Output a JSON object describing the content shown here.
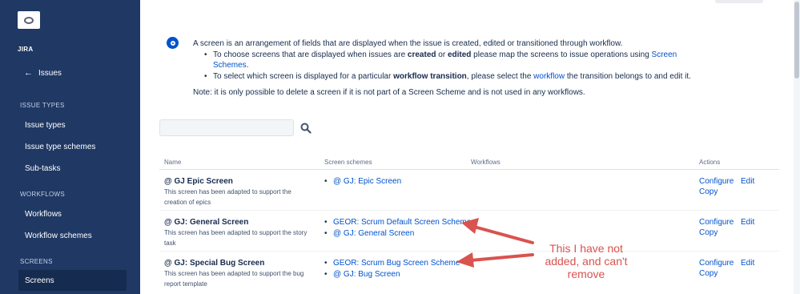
{
  "sidebar": {
    "project": "JIRA",
    "back_label": "Issues",
    "sections": {
      "issue_types": "ISSUE TYPES",
      "workflows": "WORKFLOWS",
      "screens": "SCREENS"
    },
    "items": {
      "issue_types": "Issue types",
      "issue_type_schemes": "Issue type schemes",
      "sub_tasks": "Sub-tasks",
      "workflows": "Workflows",
      "workflow_schemes": "Workflow schemes",
      "screens": "Screens"
    }
  },
  "info": {
    "intro": "A screen is an arrangement of fields that are displayed when the issue is created, edited or transitioned through workflow.",
    "bullet1": {
      "a": "To choose screens that are displayed when issues are ",
      "b1": "created",
      "c": " or ",
      "b2": "edited",
      "d": " please map the screens to issue operations using ",
      "link": "Screen Schemes",
      "e": "."
    },
    "bullet2": {
      "a": "To select which screen is displayed for a particular ",
      "b": "workflow transition",
      "c": ", please select the ",
      "link": "workflow",
      "d": " the transition belongs to and edit it."
    },
    "note": "Note: it is only possible to delete a screen if it is not part of a Screen Scheme and is not used in any workflows."
  },
  "search": {
    "value": "",
    "placeholder": ""
  },
  "table": {
    "headers": {
      "name": "Name",
      "screen_schemes": "Screen schemes",
      "workflows": "Workflows",
      "actions": "Actions"
    },
    "rows": [
      {
        "name": "@ GJ Epic Screen",
        "description": "This screen has been adapted to support the creation of epics",
        "schemes": [
          "@ GJ: Epic Screen"
        ],
        "configure": "Configure",
        "edit": "Edit",
        "copy": "Copy"
      },
      {
        "name": "@ GJ: General Screen",
        "description": "This screen has been adapted to support the story task",
        "schemes": [
          "GEOR: Scrum Default Screen Scheme",
          "@ GJ: General Screen"
        ],
        "configure": "Configure",
        "edit": "Edit",
        "copy": "Copy"
      },
      {
        "name": "@ GJ: Special Bug Screen",
        "description": "This screen has been adapted to support the bug report template",
        "schemes": [
          "GEOR: Scrum Bug Screen Scheme",
          "@ GJ: Bug Screen"
        ],
        "configure": "Configure",
        "edit": "Edit",
        "copy": "Copy"
      }
    ]
  },
  "annotation": {
    "line1": "This I have not",
    "line2": "added, and can't",
    "line3": "remove",
    "color": "#d9534f"
  },
  "colors": {
    "sidebar": "#1f3864",
    "link": "#0052cc",
    "info_icon": "#0052cc"
  }
}
